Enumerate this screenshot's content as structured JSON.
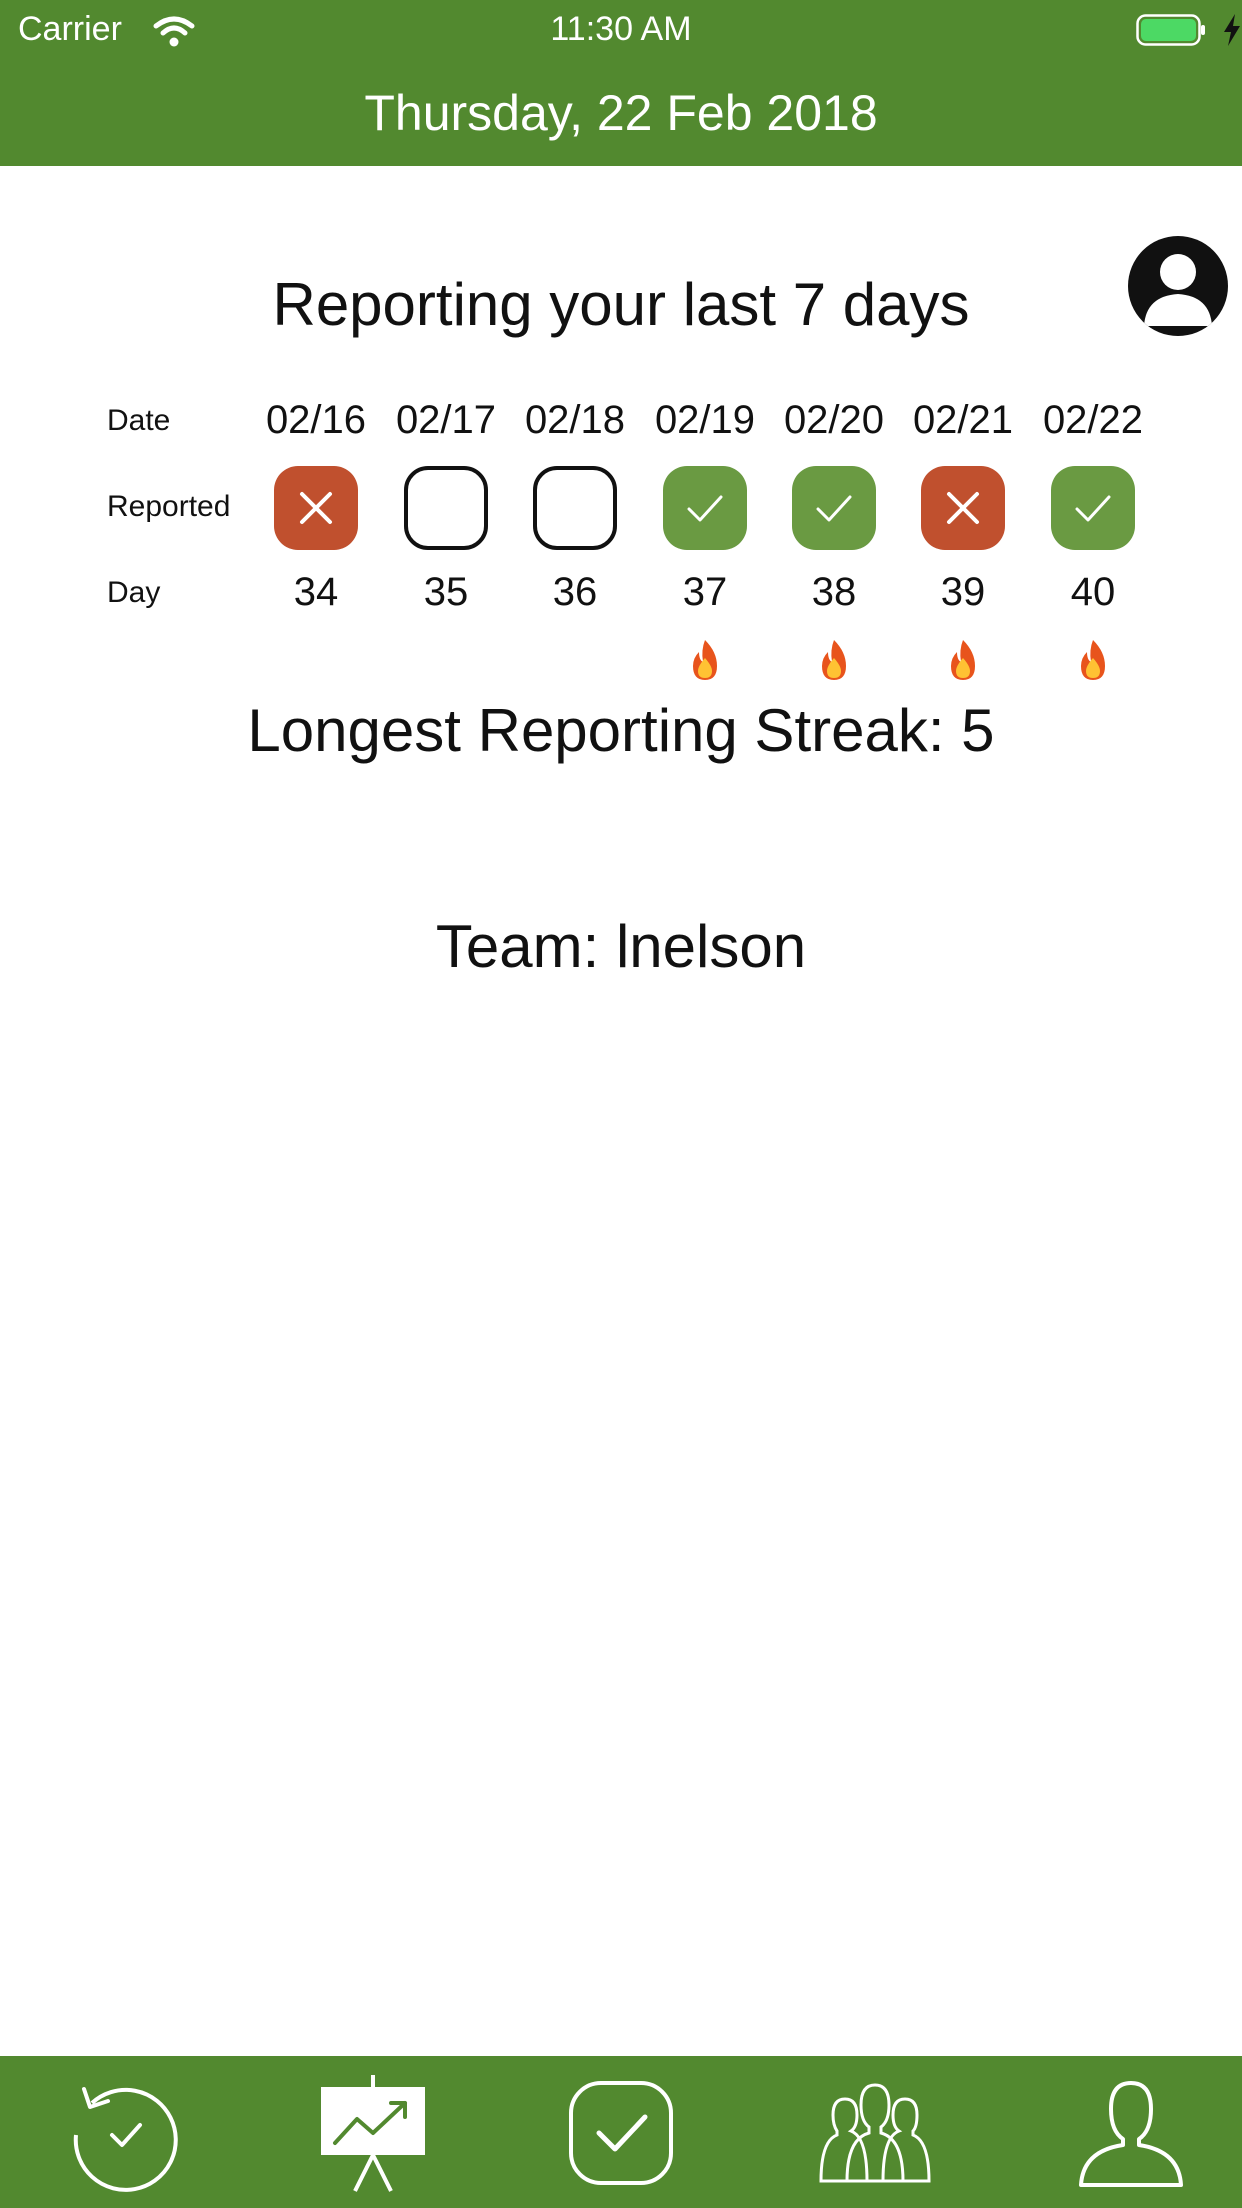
{
  "status_bar": {
    "carrier": "Carrier",
    "time": "11:30 AM"
  },
  "header": {
    "title": "Thursday, 22 Feb 2018"
  },
  "main": {
    "heading": "Reporting your last 7 days",
    "row_labels": {
      "date": "Date",
      "reported": "Reported",
      "day": "Day"
    },
    "days": [
      {
        "date": "02/16",
        "status": "missed",
        "day": "34",
        "streak": false
      },
      {
        "date": "02/17",
        "status": "none",
        "day": "35",
        "streak": false
      },
      {
        "date": "02/18",
        "status": "none",
        "day": "36",
        "streak": false
      },
      {
        "date": "02/19",
        "status": "reported",
        "day": "37",
        "streak": true
      },
      {
        "date": "02/20",
        "status": "reported",
        "day": "38",
        "streak": true
      },
      {
        "date": "02/21",
        "status": "missed",
        "day": "39",
        "streak": true
      },
      {
        "date": "02/22",
        "status": "reported",
        "day": "40",
        "streak": true
      }
    ],
    "streak_text": "Longest Reporting Streak: 5",
    "team_text": "Team: lnelson"
  },
  "tabbar": {
    "tabs": [
      {
        "icon": "history-check-icon",
        "active": false
      },
      {
        "icon": "chart-presentation-icon",
        "active": true
      },
      {
        "icon": "checkbox-icon",
        "active": false
      },
      {
        "icon": "team-icon",
        "active": false
      },
      {
        "icon": "user-icon",
        "active": false
      }
    ]
  },
  "colors": {
    "brand": "#52892f",
    "missed": "#c0502e",
    "reported": "#6a9a42"
  }
}
